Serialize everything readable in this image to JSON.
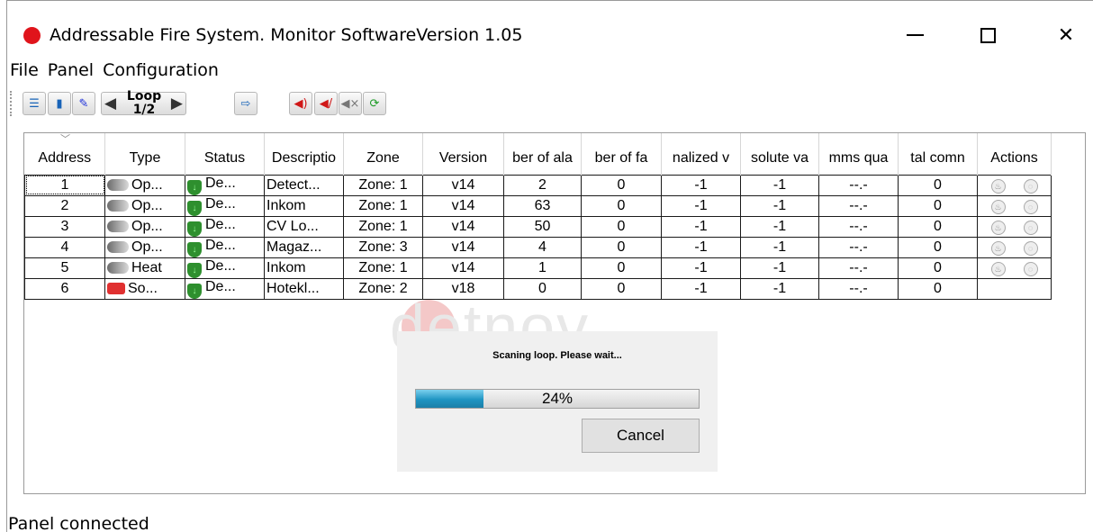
{
  "window": {
    "title": "Addressable Fire System. Monitor SoftwareVersion 1.05"
  },
  "menu": [
    "File",
    "Panel",
    "Configuration"
  ],
  "toolbar": {
    "loop_label": "Loop 1/2",
    "loop_prev": "◀",
    "loop_next": "▶"
  },
  "table": {
    "columns": [
      "Address",
      "Type",
      "Status",
      "Descriptio",
      "Zone",
      "Version",
      "ber of ala",
      "ber of fa",
      "nalized v",
      "solute va",
      "mms qua",
      "tal comn",
      "Actions"
    ],
    "rows": [
      {
        "address": "1",
        "type": "Op...",
        "status": "De...",
        "description": "Detect...",
        "zone": "Zone: 1",
        "version": "v14",
        "alarms": "2",
        "faults": "0",
        "normalized": "-1",
        "absolute": "-1",
        "comms_quality": "--.-",
        "total_comm": "0",
        "actions": true,
        "type_icon": "optical-detector-icon"
      },
      {
        "address": "2",
        "type": "Op...",
        "status": "De...",
        "description": "Inkom",
        "zone": "Zone: 1",
        "version": "v14",
        "alarms": "63",
        "faults": "0",
        "normalized": "-1",
        "absolute": "-1",
        "comms_quality": "--.-",
        "total_comm": "0",
        "actions": true,
        "type_icon": "optical-detector-icon"
      },
      {
        "address": "3",
        "type": "Op...",
        "status": "De...",
        "description": "CV Lo...",
        "zone": "Zone: 1",
        "version": "v14",
        "alarms": "50",
        "faults": "0",
        "normalized": "-1",
        "absolute": "-1",
        "comms_quality": "--.-",
        "total_comm": "0",
        "actions": true,
        "type_icon": "optical-detector-icon"
      },
      {
        "address": "4",
        "type": "Op...",
        "status": "De...",
        "description": "Magaz...",
        "zone": "Zone: 3",
        "version": "v14",
        "alarms": "4",
        "faults": "0",
        "normalized": "-1",
        "absolute": "-1",
        "comms_quality": "--.-",
        "total_comm": "0",
        "actions": true,
        "type_icon": "optical-detector-icon"
      },
      {
        "address": "5",
        "type": "Heat",
        "status": "De...",
        "description": "Inkom",
        "zone": "Zone: 1",
        "version": "v14",
        "alarms": "1",
        "faults": "0",
        "normalized": "-1",
        "absolute": "-1",
        "comms_quality": "--.-",
        "total_comm": "0",
        "actions": true,
        "type_icon": "heat-detector-icon"
      },
      {
        "address": "6",
        "type": "So...",
        "status": "De...",
        "description": "Hotekl...",
        "zone": "Zone: 2",
        "version": "v18",
        "alarms": "0",
        "faults": "0",
        "normalized": "-1",
        "absolute": "-1",
        "comms_quality": "--.-",
        "total_comm": "0",
        "actions": false,
        "type_icon": "sounder-icon"
      }
    ]
  },
  "watermark": "detnov",
  "dialog": {
    "message": "Scaning loop. Please wait...",
    "progress": 24,
    "progress_label": "24%",
    "cancel_label": "Cancel"
  },
  "status": {
    "text": "Panel connected"
  },
  "colors": {
    "app_dot": "#e0141b",
    "progress_fill": "#1f94c2",
    "status_ok": "#2e8f2e"
  }
}
